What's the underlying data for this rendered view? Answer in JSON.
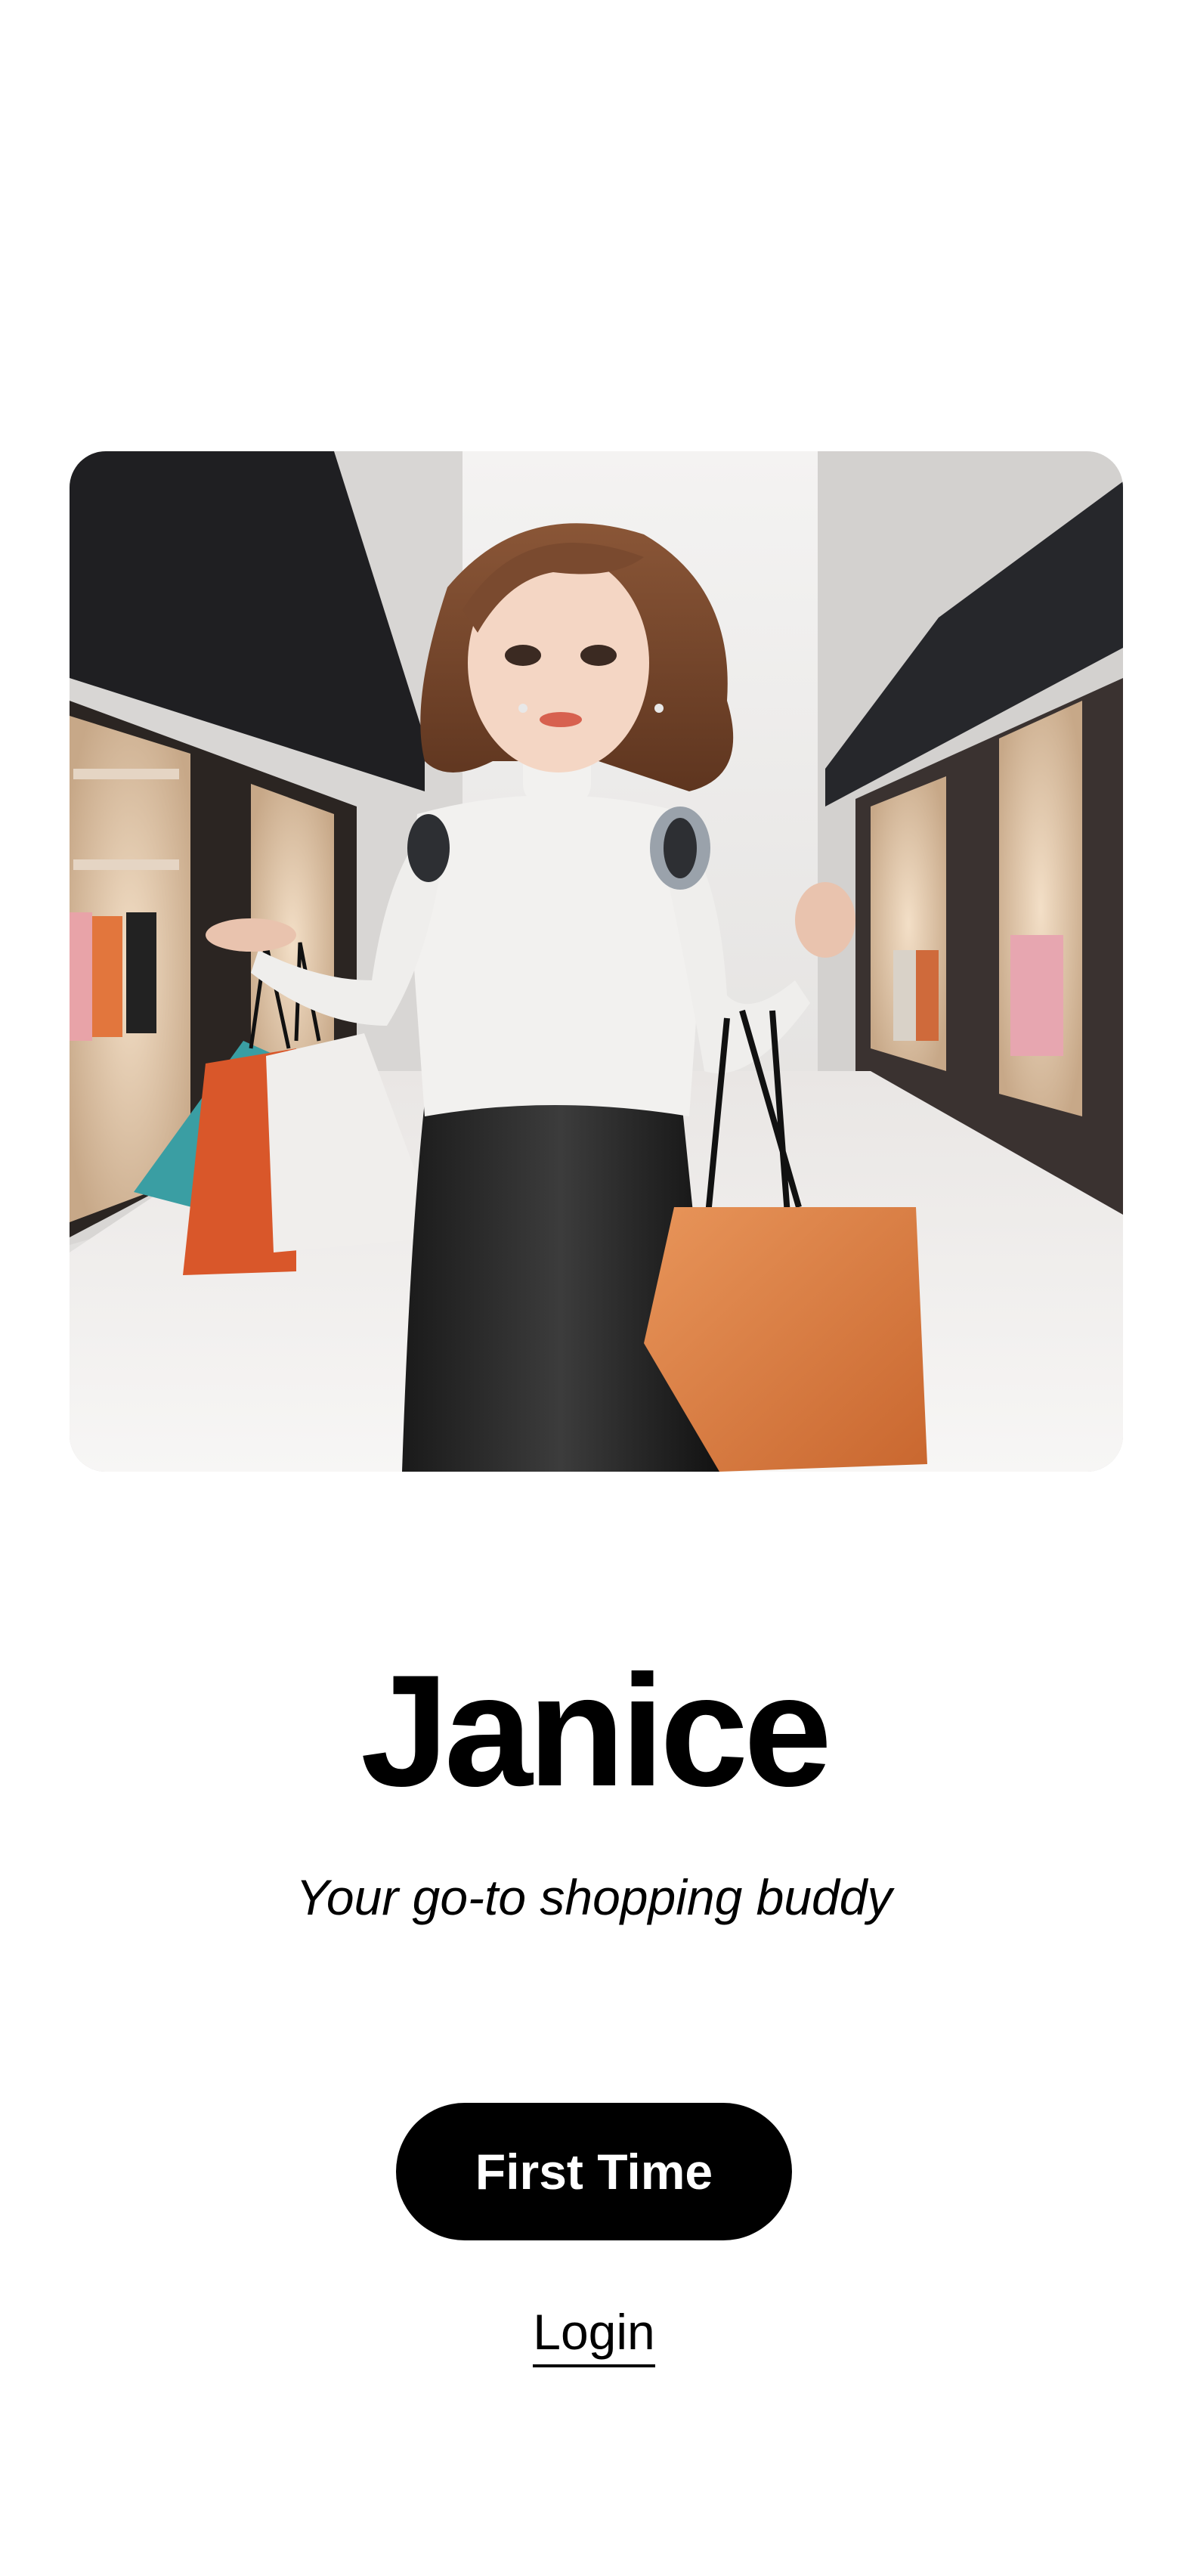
{
  "hero": {
    "image_subject": "robot-shopping-assistant-illustration"
  },
  "title": "Janice",
  "subtitle": "Your go-to shopping buddy",
  "actions": {
    "first_time_label": "First Time",
    "login_label": "Login"
  },
  "colors": {
    "background": "#ffffff",
    "primary_button": "#000000",
    "primary_button_text": "#ffffff"
  }
}
